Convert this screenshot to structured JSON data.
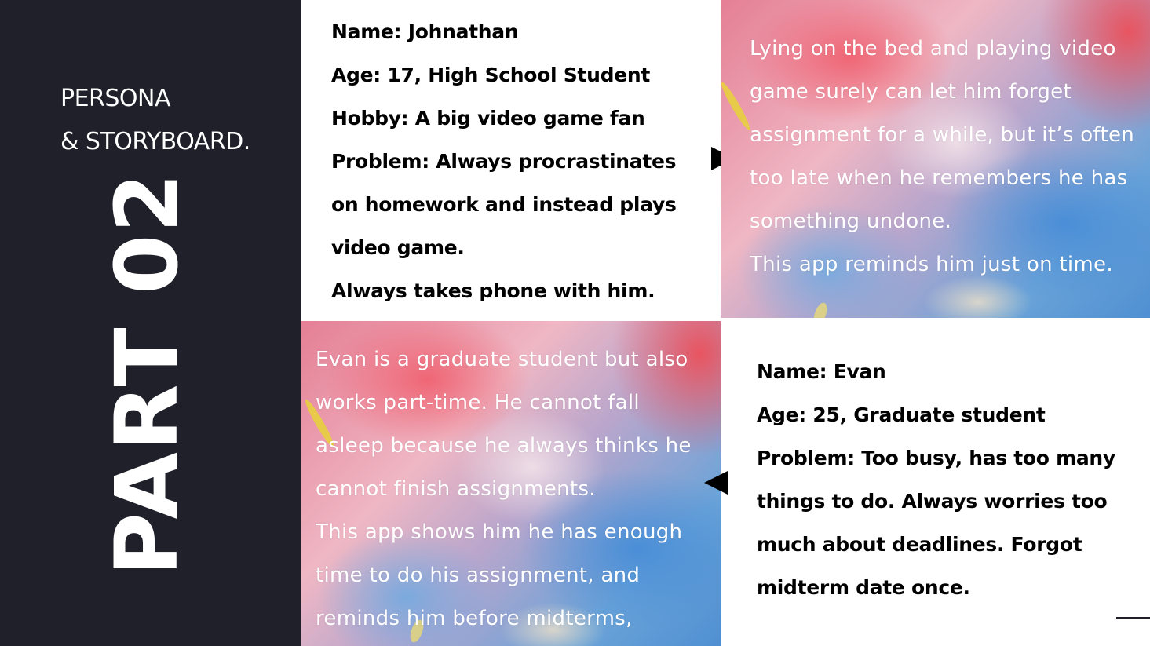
{
  "left_panel": {
    "kicker_lines": [
      "PERSONA",
      "& STORYBOARD."
    ],
    "part_title": "PART 02"
  },
  "persona_johnathan": {
    "lines": [
      "Name: Johnathan",
      "Age: 17, High School Student",
      "Hobby: A big video game fan",
      "Problem: Always procrastinates",
      "on homework and instead plays",
      "video game.",
      "Always takes phone with him."
    ]
  },
  "story_johnathan": {
    "lines": [
      "Lying on the bed and playing video",
      "game surely can let him forget",
      "assignment for a while, but it’s often",
      "too late when he remembers he has",
      "something undone.",
      "This app reminds him just on time."
    ]
  },
  "story_evan": {
    "lines": [
      "Evan is a graduate student but also",
      "works part-time.  He cannot fall",
      "asleep because he always thinks he",
      "cannot finish assignments.",
      "This app shows him he has enough",
      "time to do his assignment, and",
      "reminds him before midterms,"
    ]
  },
  "persona_evan": {
    "lines": [
      "Name: Evan",
      "Age: 25, Graduate student",
      "Problem: Too busy, has too many",
      "things to do. Always worries too",
      "much about deadlines. Forgot",
      "midterm date once."
    ]
  },
  "icons": {
    "arrow_right": "triangle-right-icon",
    "arrow_left": "triangle-left-icon"
  },
  "colors": {
    "panel_dark": "#1f2029",
    "text_light": "#ffffff",
    "text_dark": "#000000"
  }
}
